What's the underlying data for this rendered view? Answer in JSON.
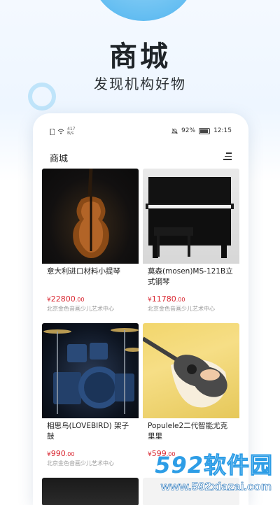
{
  "hero": {
    "title": "商城",
    "subtitle": "发现机构好物"
  },
  "status_bar": {
    "speed_value": "417",
    "speed_unit": "B/s",
    "battery": "92%",
    "time": "12:15"
  },
  "navbar": {
    "title": "商城"
  },
  "products": [
    {
      "name": "意大利进口材料小提琴",
      "price_main": "22800",
      "price_cents": ".00",
      "shop": "北京金色音画少儿艺术中心"
    },
    {
      "name": "莫森(mosen)MS-121B立式钢琴",
      "price_main": "11780",
      "price_cents": ".00",
      "shop": "北京金色音画少儿艺术中心"
    },
    {
      "name": "相思鸟(LOVEBIRD) 架子鼓",
      "price_main": "990",
      "price_cents": ".00",
      "shop": "北京金色音画少儿艺术中心"
    },
    {
      "name": "Populele2二代智能尤克里里",
      "price_main": "599",
      "price_cents": ".00",
      "shop": ""
    }
  ],
  "currency": "¥",
  "watermark": {
    "number": "592",
    "text": "软件园",
    "url": "www.592xiazai.com"
  }
}
